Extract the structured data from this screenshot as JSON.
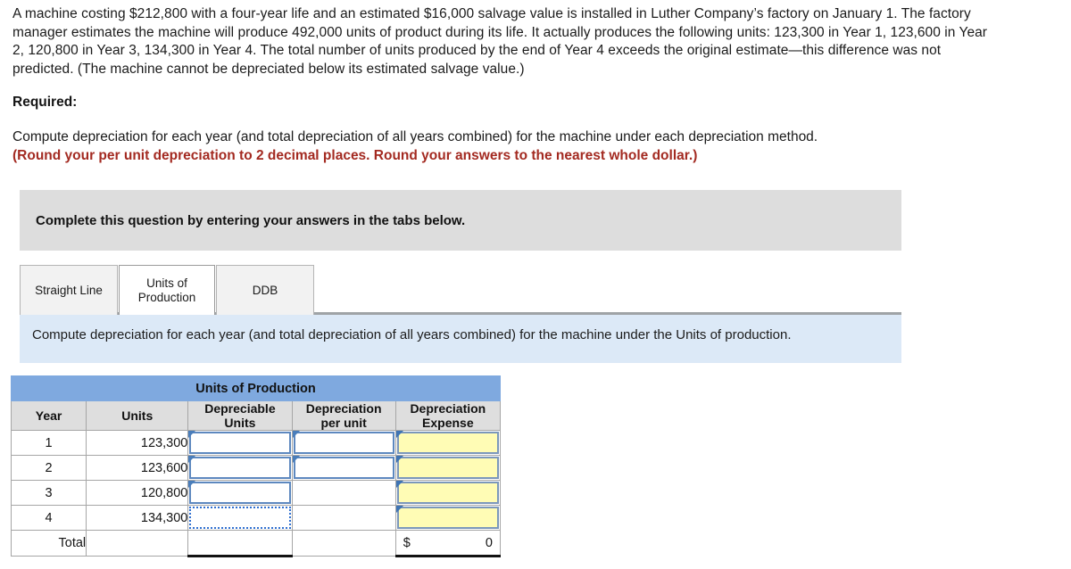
{
  "problem": {
    "text": "A machine costing $212,800 with a four-year life and an estimated $16,000 salvage value is installed in Luther Company’s factory on January 1. The factory manager estimates the machine will produce 492,000 units of product during its life. It actually produces the following units: 123,300 in Year 1, 123,600 in Year 2, 120,800 in Year 3, 134,300 in Year 4. The total number of units produced by the end of Year 4 exceeds the original estimate—this difference was not predicted. (The machine cannot be depreciated below its estimated salvage value.)"
  },
  "required": {
    "label": "Required:",
    "body": "Compute depreciation for each year (and total depreciation of all years combined) for the machine under each depreciation method.",
    "round_note": "(Round your per unit depreciation to 2 decimal places. Round your answers to the nearest whole dollar.)"
  },
  "complete_bar": {
    "text": "Complete this question by entering your answers in the tabs below."
  },
  "tabs": {
    "items": [
      {
        "label": "Straight Line",
        "active": false
      },
      {
        "label": "Units of Production",
        "active": true
      },
      {
        "label": "DDB",
        "active": false
      }
    ]
  },
  "info_box": {
    "text": "Compute depreciation for each year (and total depreciation of all years combined) for the machine under the Units of production."
  },
  "table": {
    "title": "Units of Production",
    "headers": [
      "Year",
      "Units",
      "Depreciable Units",
      "Depreciation per unit",
      "Depreciation Expense"
    ],
    "headers_lines": [
      [
        "Year"
      ],
      [
        "Units"
      ],
      [
        "Depreciable",
        "Units"
      ],
      [
        "Depreciation",
        "per unit"
      ],
      [
        "Depreciation",
        "Expense"
      ]
    ],
    "rows": [
      {
        "year": "1",
        "units": "123,300",
        "depreciable_units": "",
        "dep_per_unit": "",
        "dep_expense": ""
      },
      {
        "year": "2",
        "units": "123,600",
        "depreciable_units": "",
        "dep_per_unit": "",
        "dep_expense": ""
      },
      {
        "year": "3",
        "units": "120,800",
        "depreciable_units": "",
        "dep_per_unit": "",
        "dep_expense": ""
      },
      {
        "year": "4",
        "units": "134,300",
        "depreciable_units": "",
        "dep_per_unit": "",
        "dep_expense": ""
      }
    ],
    "total_row": {
      "label": "Total",
      "units": "",
      "depreciable_units": "",
      "dep_per_unit": "",
      "currency_symbol": "$",
      "dep_expense": "0"
    }
  },
  "colors": {
    "title_blue": "#7fa9df",
    "header_gray": "#dedede",
    "answer_yellow": "#fffcb5",
    "info_blue": "#dce9f7",
    "complete_gray": "#dddddd",
    "warning_red": "#a32a21",
    "input_border_blue": "#5d88bf",
    "selection_dotted_blue": "#2f6fd0"
  }
}
